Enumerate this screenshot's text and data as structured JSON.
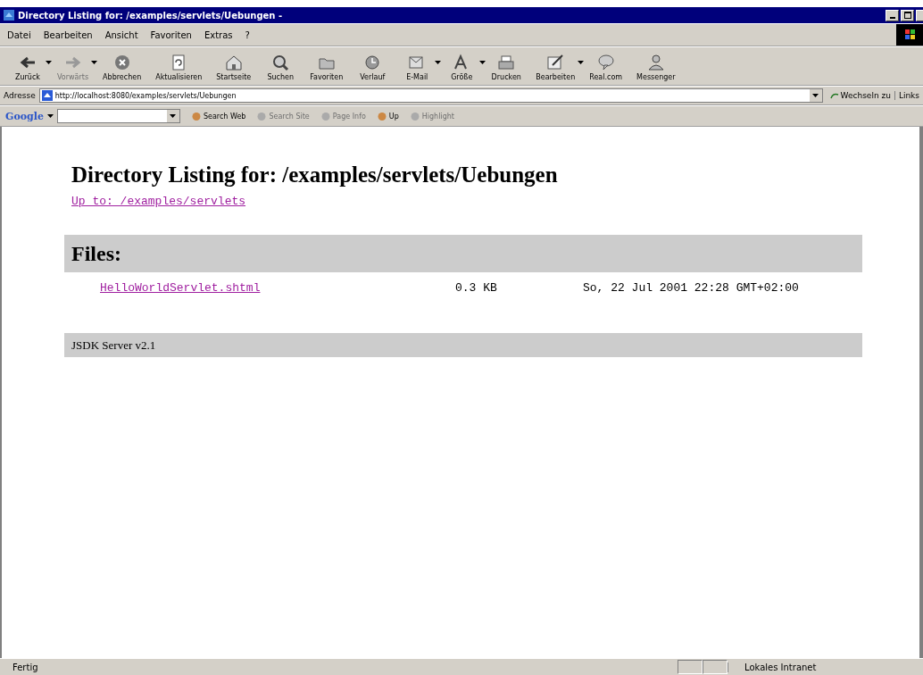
{
  "window": {
    "title": "Directory Listing for: /examples/servlets/Uebungen -"
  },
  "menu": [
    "Datei",
    "Bearbeiten",
    "Ansicht",
    "Favoriten",
    "Extras",
    "?"
  ],
  "toolbar": [
    {
      "label": "Zurück",
      "disabled": false,
      "dropdown": true
    },
    {
      "label": "Vorwärts",
      "disabled": true,
      "dropdown": true
    },
    {
      "label": "Abbrechen",
      "disabled": false,
      "dropdown": false
    },
    {
      "label": "Aktualisieren",
      "disabled": false,
      "dropdown": false
    },
    {
      "label": "Startseite",
      "disabled": false,
      "dropdown": false
    },
    {
      "label": "Suchen",
      "disabled": false,
      "dropdown": false
    },
    {
      "label": "Favoriten",
      "disabled": false,
      "dropdown": false
    },
    {
      "label": "Verlauf",
      "disabled": false,
      "dropdown": false
    },
    {
      "label": "E-Mail",
      "disabled": false,
      "dropdown": true
    },
    {
      "label": "Größe",
      "disabled": false,
      "dropdown": true
    },
    {
      "label": "Drucken",
      "disabled": false,
      "dropdown": false
    },
    {
      "label": "Bearbeiten",
      "disabled": false,
      "dropdown": true
    },
    {
      "label": "Real.com",
      "disabled": false,
      "dropdown": false
    },
    {
      "label": "Messenger",
      "disabled": false,
      "dropdown": false
    }
  ],
  "address_bar": {
    "label": "Adresse",
    "url": "http://localhost:8080/examples/servlets/Uebungen",
    "go": "Wechseln zu",
    "links": "Links"
  },
  "google_bar": {
    "logo": "Google",
    "buttons": [
      {
        "label": "Search Web",
        "disabled": false
      },
      {
        "label": "Search Site",
        "disabled": true
      },
      {
        "label": "Page Info",
        "disabled": true
      },
      {
        "label": "Up",
        "disabled": false
      },
      {
        "label": "Highlight",
        "disabled": true
      }
    ]
  },
  "page": {
    "heading": "Directory Listing for: /examples/servlets/Uebungen",
    "up_link": "Up to: /examples/servlets",
    "files_heading": "Files:",
    "files": [
      {
        "name": "HelloWorldServlet.shtml",
        "size": "0.3 KB",
        "modified": "So, 22 Jul 2001 22:28 GMT+02:00"
      }
    ],
    "footer": "JSDK Server v2.1"
  },
  "status_bar": {
    "text": "Fertig",
    "zone": "Lokales Intranet"
  }
}
